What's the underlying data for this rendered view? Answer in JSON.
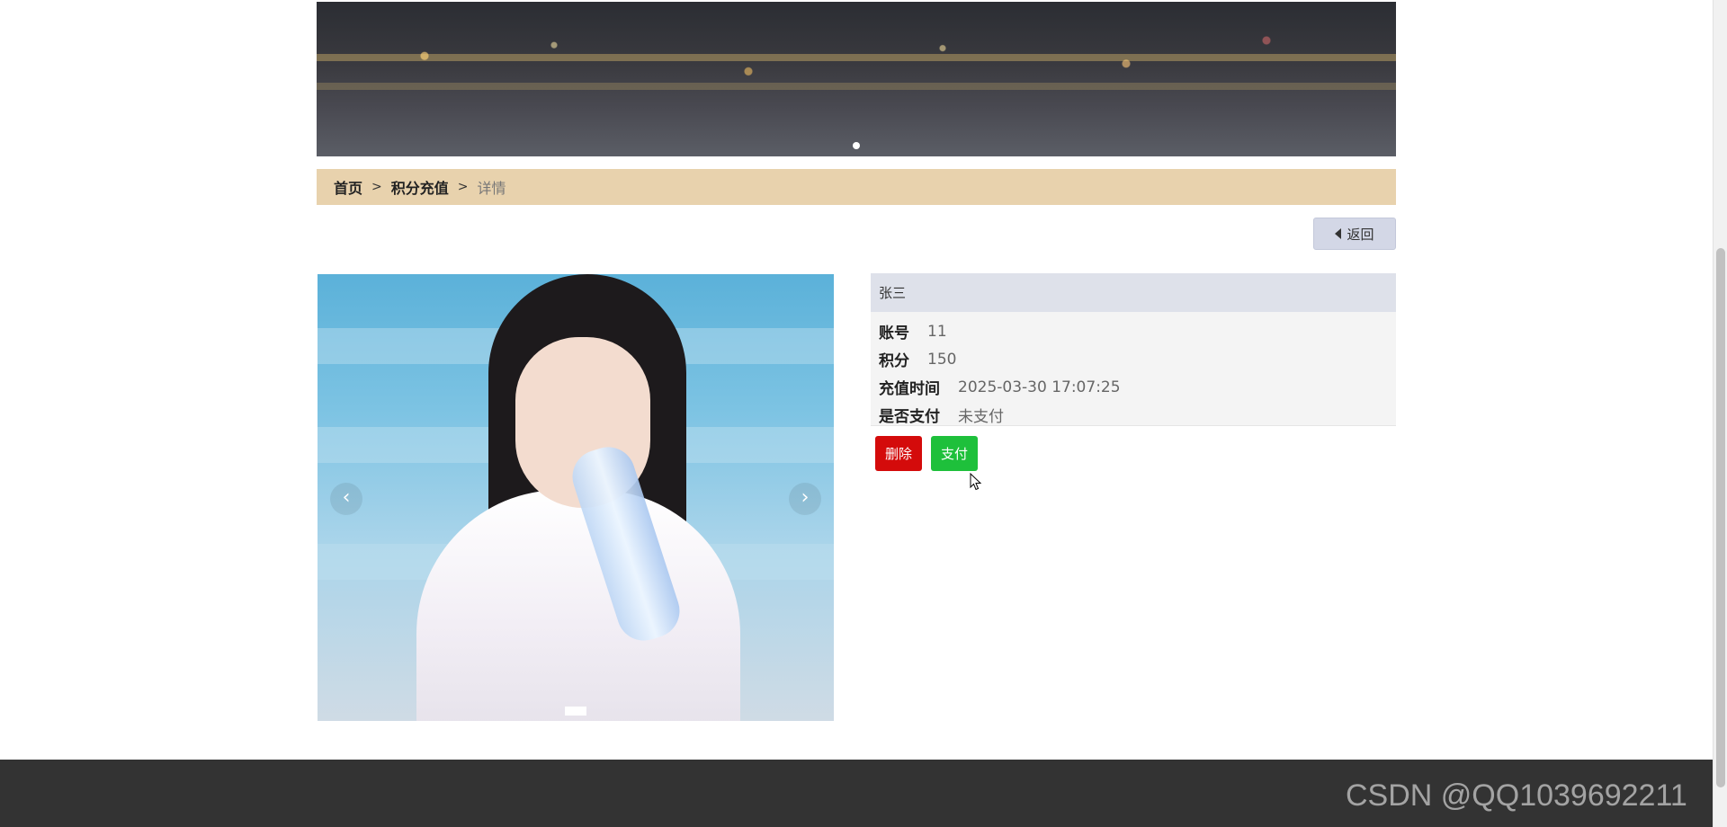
{
  "banner": {
    "slide_count": 1,
    "active_slide": 1
  },
  "breadcrumb": {
    "home": "首页",
    "section": "积分充值",
    "current": "详情",
    "separator": ">"
  },
  "back_button": {
    "label": "返回",
    "icon": "caret-left-icon"
  },
  "carousel": {
    "prev_glyph": "‹",
    "next_glyph": "›"
  },
  "detail": {
    "title": "张三",
    "fields": [
      {
        "label": "账号",
        "value": "11"
      },
      {
        "label": "积分",
        "value": "150"
      },
      {
        "label": "充值时间",
        "value": "2025-03-30 17:07:25"
      },
      {
        "label": "是否支付",
        "value": "未支付"
      }
    ]
  },
  "actions": {
    "delete_label": "删除",
    "pay_label": "支付"
  },
  "watermark": {
    "text": "CSDN @QQ1039692211"
  },
  "colors": {
    "breadcrumb_bg": "#e8d2ad",
    "back_button_bg": "#d3d7e6",
    "delete_button": "#d40b0b",
    "pay_button": "#1ec03b",
    "footer_bg": "#333333",
    "detail_header_bg": "#dee1ea"
  }
}
